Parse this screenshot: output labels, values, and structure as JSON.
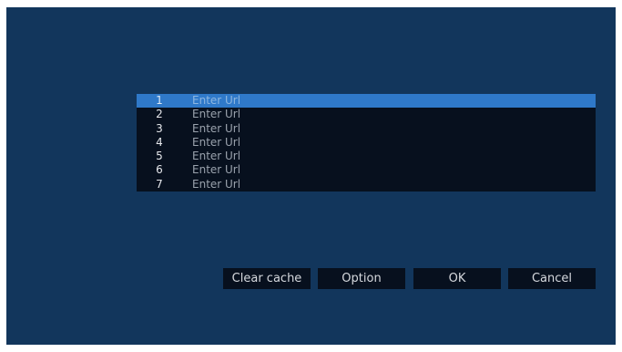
{
  "url_list": {
    "selected_index": 0,
    "rows": [
      {
        "num": "1",
        "value": "Enter Url"
      },
      {
        "num": "2",
        "value": "Enter Url"
      },
      {
        "num": "3",
        "value": "Enter Url"
      },
      {
        "num": "4",
        "value": "Enter Url"
      },
      {
        "num": "5",
        "value": "Enter Url"
      },
      {
        "num": "6",
        "value": "Enter Url"
      },
      {
        "num": "7",
        "value": "Enter Url"
      }
    ]
  },
  "buttons": {
    "clear_cache": "Clear cache",
    "option": "Option",
    "ok": "OK",
    "cancel": "Cancel"
  },
  "colors": {
    "background": "#12365c",
    "panel": "#07101e",
    "selected_row": "#2f79c9"
  }
}
